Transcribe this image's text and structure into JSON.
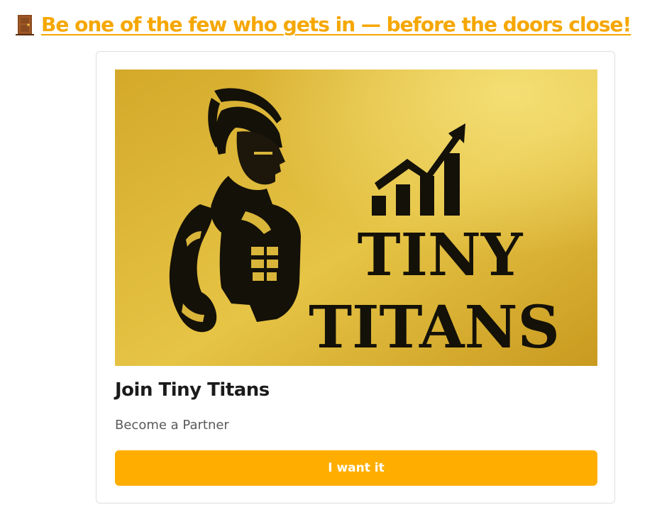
{
  "headline": {
    "icon": "door-icon",
    "text": " Be one of the few who gets in — before the doors close!"
  },
  "card": {
    "image": {
      "alt": "Tiny Titans logo",
      "logo_text_line1": "TINY",
      "logo_text_line2": "TITANS",
      "figure_icon": "spartan-warrior-icon",
      "chart_icon": "growth-chart-icon"
    },
    "title": "Join Tiny Titans",
    "subtitle": "Become a Partner",
    "button_label": "I want it"
  },
  "colors": {
    "accent": "#ffae00",
    "link": "#f5a700",
    "gold_light": "#f2dc6a",
    "gold_dark": "#c2961e",
    "ink": "#141108"
  }
}
